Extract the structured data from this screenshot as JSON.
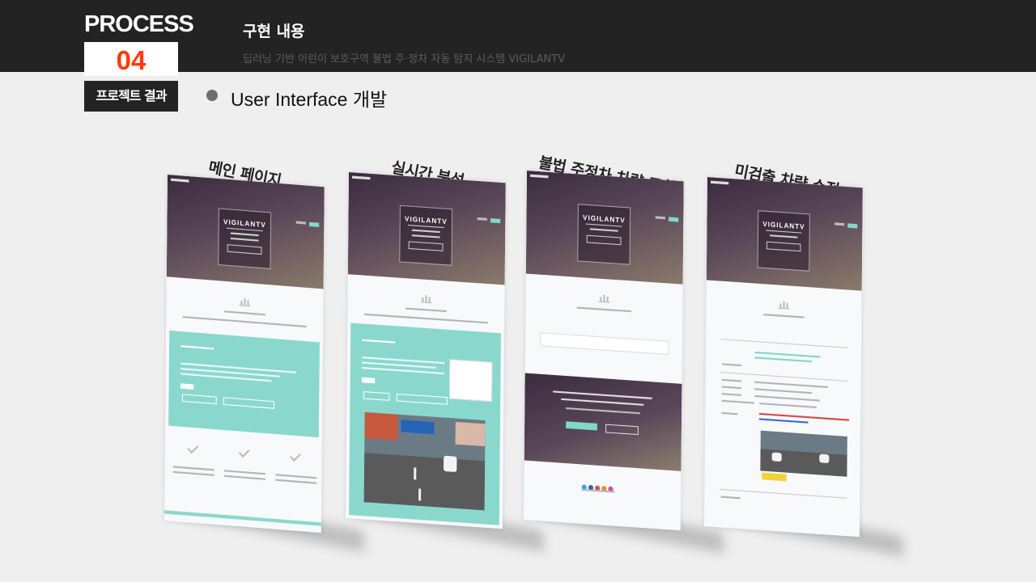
{
  "header": {
    "section_label": "PROCESS",
    "section_number": "04",
    "section_subtitle": "프로젝트 결과",
    "title": "구현 내용",
    "subtitle": "딥러닝 기반 어린이 보호구역 불법 주·정차 자동 탐지 시스템 VIGILANTV"
  },
  "section": {
    "title": "User Interface 개발"
  },
  "screens": [
    {
      "caption": "메인 페이지",
      "logo": "VIGILANTV"
    },
    {
      "caption": "실시간 분석",
      "logo": "VIGILANTV"
    },
    {
      "caption": "불법 주정차 차량 조회",
      "logo": "VIGILANTV"
    },
    {
      "caption": "미검출 차량 수정",
      "logo": "VIGILANTV"
    }
  ],
  "colors": {
    "accent": "#ff3b0a",
    "topbar": "#232323",
    "mint": "#8ad8cd",
    "hero": "#4a3a4c"
  }
}
